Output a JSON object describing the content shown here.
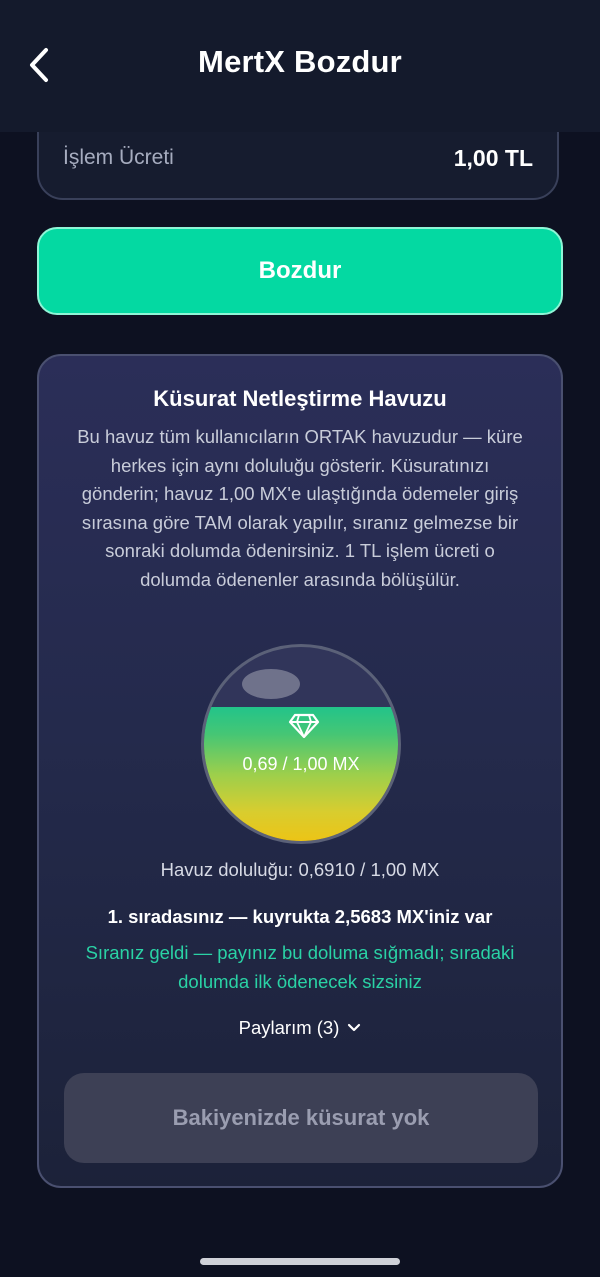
{
  "header": {
    "title": "MertX Bozdur"
  },
  "fee": {
    "label": "İşlem Ücreti",
    "value": "1,00 TL"
  },
  "primary_button": {
    "label": "Bozdur"
  },
  "pool": {
    "title": "Küsurat Netleştirme Havuzu",
    "description": "Bu havuz tüm kullanıcıların ORTAK havuzudur — küre herkes için aynı doluluğu gösterir. Küsuratınızı gönderin; havuz 1,00 MX'e ulaştığında ödemeler giriş sırasına göre TAM olarak yapılır, sıranız gelmezse bir sonraki dolumda ödenirsiniz. 1 TL işlem ücreti o dolumda ödenenler arasında bölüşülür.",
    "sphere_value": "0,69 / 1,00 MX",
    "fill_fraction": 0.691,
    "fill_text": "Havuz doluluğu: 0,6910 / 1,00 MX",
    "queue_text": "1. sıradasınız — kuyrukta 2,5683 MX'iniz var",
    "status_text": "Sıranız geldi — payınız bu doluma sığmadı; sıradaki dolumda ilk ödenecek sizsiniz",
    "shares_label": "Paylarım (3)",
    "disabled_button": "Bakiyenizde küsurat yok"
  },
  "colors": {
    "background": "#0d1121",
    "accent": "#04d9a2",
    "status": "#2ad2a5"
  }
}
